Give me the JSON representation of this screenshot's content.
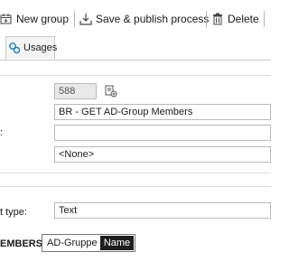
{
  "toolbar": {
    "new_group_label": "New group",
    "save_publish_label": "Save & publish process",
    "delete_label": "Delete"
  },
  "tabs": [
    {
      "label": "Usages"
    }
  ],
  "form": {
    "id_value": "588",
    "name_value": "BR - GET AD-Group Members",
    "third_label": ":",
    "third_value": "",
    "select_value": "<None>",
    "type_label": "t type:",
    "type_value": "Text"
  },
  "members": {
    "label": "EMBERS",
    "chip_text": "AD-Gruppe",
    "chip_name": "Name"
  },
  "icons": {
    "new_group": "new-group-icon",
    "save_publish": "save-publish-icon",
    "delete": "trash-icon",
    "usages": "usages-icon",
    "edit_id": "edit-id-icon"
  }
}
